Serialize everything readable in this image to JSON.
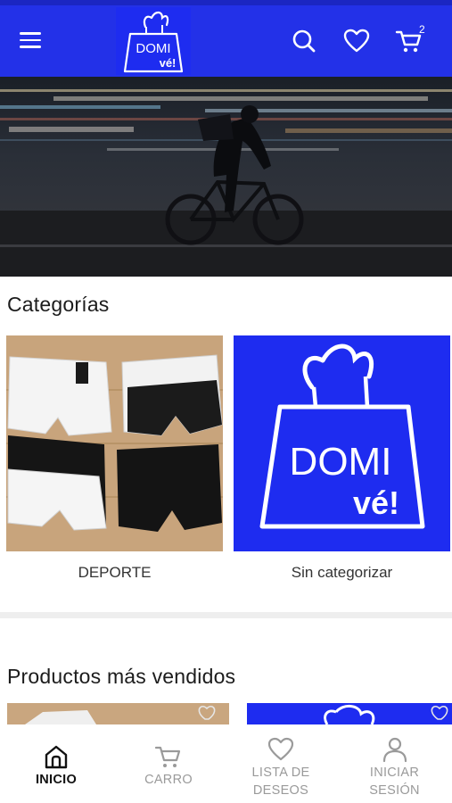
{
  "header": {
    "logo_text_line1": "DOMI",
    "logo_text_line2": "vé!",
    "cart_count": "2",
    "icons": [
      "menu-icon",
      "search-icon",
      "heart-icon",
      "cart-icon"
    ]
  },
  "hero": {
    "slide_count": 2,
    "active_slide": 1
  },
  "categories": {
    "title": "Categorías",
    "items": [
      {
        "label": "DEPORTE"
      },
      {
        "label": "Sin categorizar"
      }
    ]
  },
  "best_sellers": {
    "title": "Productos más vendidos"
  },
  "bottom_nav": {
    "items": [
      {
        "label": "INICIO",
        "icon": "home-icon",
        "active": true
      },
      {
        "label": "CARRO",
        "icon": "cart-icon",
        "active": false
      },
      {
        "label": "LISTA DE DESEOS",
        "icon": "heart-icon",
        "active": false
      },
      {
        "label": "INICIAR SESIÓN",
        "icon": "user-icon",
        "active": false
      }
    ]
  },
  "colors": {
    "brand_blue": "#2331e8",
    "active_dot": "#3b82f6"
  }
}
